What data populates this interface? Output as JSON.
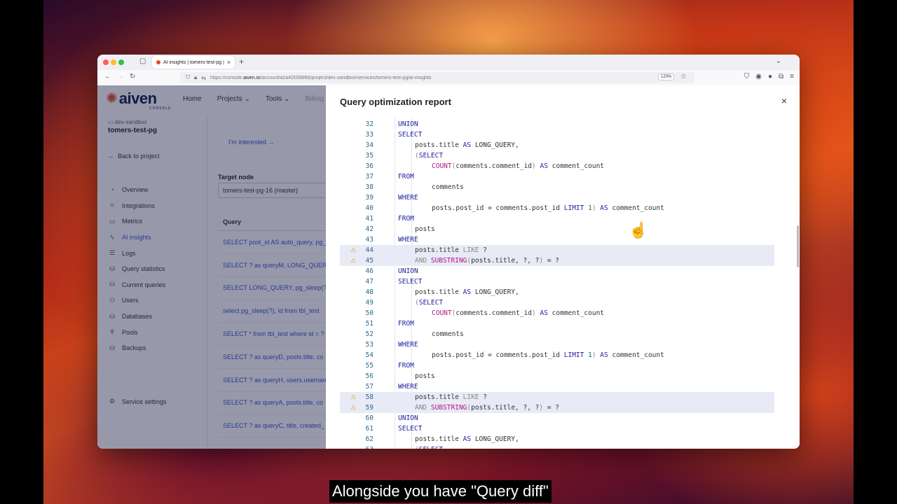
{
  "browser": {
    "tab_title": "AI insights | tomers-test-pg | Ai",
    "url_prefix": "https://console.",
    "url_domain": "aiven.io",
    "url_path": "/account/a2a42f288f66/project/dev-sandbox/services/tomers-test-pg/ai-insights",
    "zoom": "120%"
  },
  "brand": {
    "name": "aiven",
    "sub": "CONSOLE",
    "accent": "#e24c2c"
  },
  "topnav": {
    "home": "Home",
    "projects": "Projects",
    "tools": "Tools",
    "billing": "Billing"
  },
  "sidebar": {
    "project": "dev-sandbox",
    "service": "tomers-test-pg",
    "back": "Back to project",
    "items": [
      {
        "label": "Overview",
        "icon": "gauge-icon"
      },
      {
        "label": "Integrations",
        "icon": "integrations-icon"
      },
      {
        "label": "Metrics",
        "icon": "metrics-icon"
      },
      {
        "label": "AI insights",
        "icon": "bolt-icon"
      },
      {
        "label": "Logs",
        "icon": "list-icon"
      },
      {
        "label": "Query statistics",
        "icon": "database-icon"
      },
      {
        "label": "Current queries",
        "icon": "database-icon"
      },
      {
        "label": "Users",
        "icon": "users-icon"
      },
      {
        "label": "Databases",
        "icon": "database-icon"
      },
      {
        "label": "Pools",
        "icon": "pool-icon"
      },
      {
        "label": "Backups",
        "icon": "backup-icon"
      }
    ],
    "settings": "Service settings"
  },
  "main": {
    "interested": "I'm interested →",
    "target_label": "Target node",
    "target_value": "tomers-test-pg-16 (master)",
    "query_header": "Query",
    "queries": [
      "SELECT post_id AS auto_query, pg_",
      "SELECT ? as queryM, LONG_QUERY",
      "SELECT LONG_QUERY, pg_sleep(?)",
      "select pg_sleep(?), id from tbl_test",
      "SELECT * from tbl_test where id = ?",
      "SELECT ? as queryD, posts.title, co",
      "SELECT ? as queryH, users.usernam",
      "SELECT ? as queryA, posts.title, co",
      "SELECT ? as queryC, title, created_"
    ]
  },
  "report": {
    "title": "Query optimization report",
    "close": "×",
    "lines": [
      {
        "n": "32",
        "t": "UNION"
      },
      {
        "n": "33",
        "t": "SELECT"
      },
      {
        "n": "34",
        "t": "posts.title AS LONG_QUERY,"
      },
      {
        "n": "35",
        "t": "(SELECT"
      },
      {
        "n": "36",
        "t": "COUNT(comments.comment_id) AS comment_count"
      },
      {
        "n": "37",
        "t": "FROM"
      },
      {
        "n": "38",
        "t": "comments"
      },
      {
        "n": "39",
        "t": "WHERE"
      },
      {
        "n": "40",
        "t": "posts.post_id = comments.post_id LIMIT 1) AS comment_count"
      },
      {
        "n": "41",
        "t": "FROM"
      },
      {
        "n": "42",
        "t": "posts"
      },
      {
        "n": "43",
        "t": "WHERE"
      },
      {
        "n": "44",
        "t": "posts.title LIKE ?",
        "warn": true
      },
      {
        "n": "45",
        "t": "AND SUBSTRING(posts.title, ?, ?) = ?",
        "warn": true
      },
      {
        "n": "46",
        "t": "UNION"
      },
      {
        "n": "47",
        "t": "SELECT"
      },
      {
        "n": "48",
        "t": "posts.title AS LONG_QUERY,"
      },
      {
        "n": "49",
        "t": "(SELECT"
      },
      {
        "n": "50",
        "t": "COUNT(comments.comment_id) AS comment_count"
      },
      {
        "n": "51",
        "t": "FROM"
      },
      {
        "n": "52",
        "t": "comments"
      },
      {
        "n": "53",
        "t": "WHERE"
      },
      {
        "n": "54",
        "t": "posts.post_id = comments.post_id LIMIT 1) AS comment_count"
      },
      {
        "n": "55",
        "t": "FROM"
      },
      {
        "n": "56",
        "t": "posts"
      },
      {
        "n": "57",
        "t": "WHERE"
      },
      {
        "n": "58",
        "t": "posts.title LIKE ?",
        "warn": true
      },
      {
        "n": "59",
        "t": "AND SUBSTRING(posts.title, ?, ?) = ?",
        "warn": true
      },
      {
        "n": "60",
        "t": "UNION"
      },
      {
        "n": "61",
        "t": "SELECT"
      },
      {
        "n": "62",
        "t": "posts.title AS LONG_QUERY,"
      },
      {
        "n": "63",
        "t": "(SELECT"
      }
    ]
  },
  "caption": "Alongside you have \"Query diff\""
}
